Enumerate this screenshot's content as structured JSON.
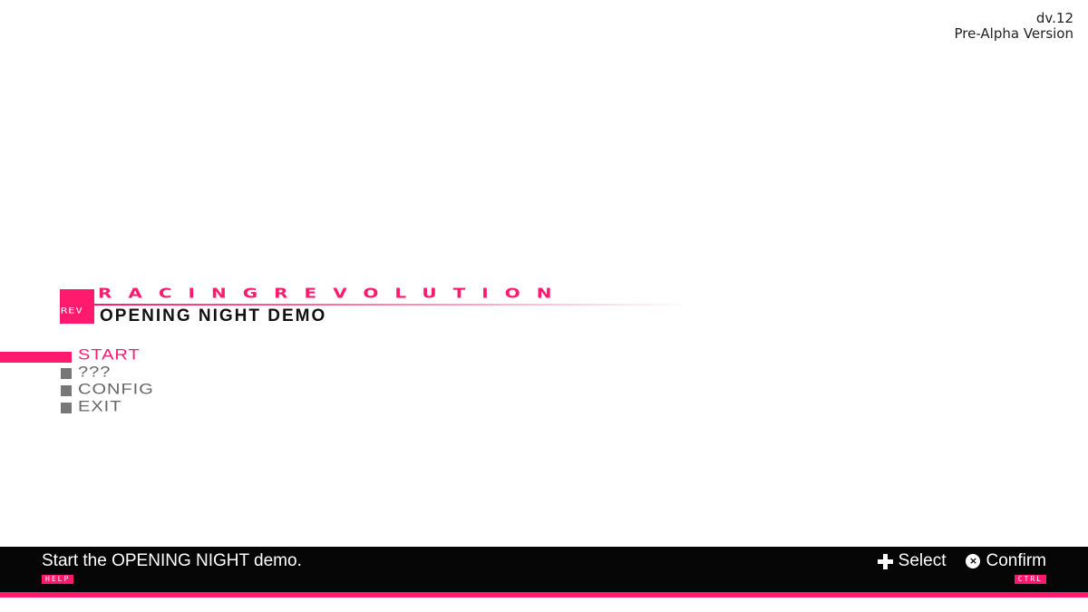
{
  "version": {
    "build": "dv.12",
    "label": "Pre-Alpha Version"
  },
  "logo": {
    "badge_text": "REV",
    "brand": "RACINGREVOLUTION",
    "subtitle": "OPENING NIGHT DEMO"
  },
  "menu": {
    "items": [
      {
        "label": "START",
        "selected": true
      },
      {
        "label": "???",
        "selected": false
      },
      {
        "label": "CONFIG",
        "selected": false
      },
      {
        "label": "EXIT",
        "selected": false
      }
    ]
  },
  "bottom_bar": {
    "help_text": "Start the OPENING NIGHT demo.",
    "help_tag": "HELP",
    "ctrl_tag": "CTRL",
    "controls": [
      {
        "icon": "dpad-icon",
        "label": "Select"
      },
      {
        "icon": "circle-x-icon",
        "label": "Confirm"
      }
    ]
  },
  "colors": {
    "accent": "#ff1a6e",
    "bar": "#060606",
    "inactive": "#777777",
    "background": "#ffffff"
  }
}
